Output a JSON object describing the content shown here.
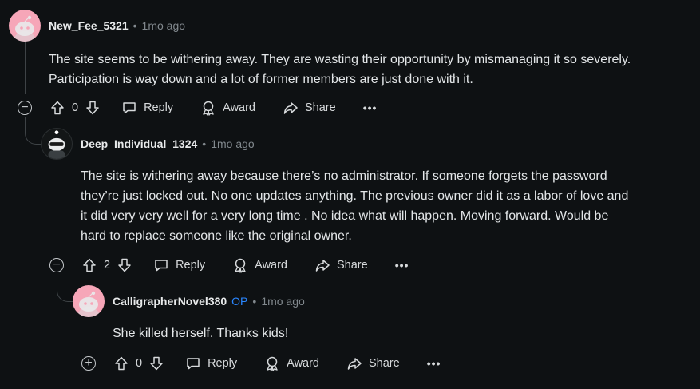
{
  "comments": [
    {
      "username": "New_Fee_5321",
      "op_badge": "",
      "time": "1mo ago",
      "body_lines": [
        "The site seems to be withering away. They are wasting their opportunity by mismanaging it so severely.",
        "Participation is way down and a lot of former members are just done with it."
      ],
      "votes": "0",
      "collapse_symbol": "−",
      "avatar": "snoo-avatar-pink"
    },
    {
      "username": "Deep_Individual_1324",
      "op_badge": "",
      "time": "1mo ago",
      "body_lines": [
        "The site is withering away because there’s no administrator. If someone forgets the password",
        "they’re just locked out. No one updates anything. The previous owner did it as a labor of love and",
        "it did very very well for a very long time . No idea what will happen. Moving forward. Would be",
        "hard to replace someone like the original owner."
      ],
      "votes": "2",
      "collapse_symbol": "−",
      "avatar": "snoo-avatar-dark"
    },
    {
      "username": "CalligrapherNovel380",
      "op_badge": "OP",
      "time": "1mo ago",
      "body_lines": [
        "She killed herself. Thanks kids!"
      ],
      "votes": "0",
      "collapse_symbol": "+",
      "avatar": "snoo-avatar-pink"
    }
  ],
  "actions": {
    "reply": "Reply",
    "award": "Award",
    "share": "Share",
    "more": "•••"
  },
  "separator": "•",
  "colors": {
    "background": "#0e1113",
    "op": "#2a86ff",
    "thread_line": "#3e4346"
  }
}
